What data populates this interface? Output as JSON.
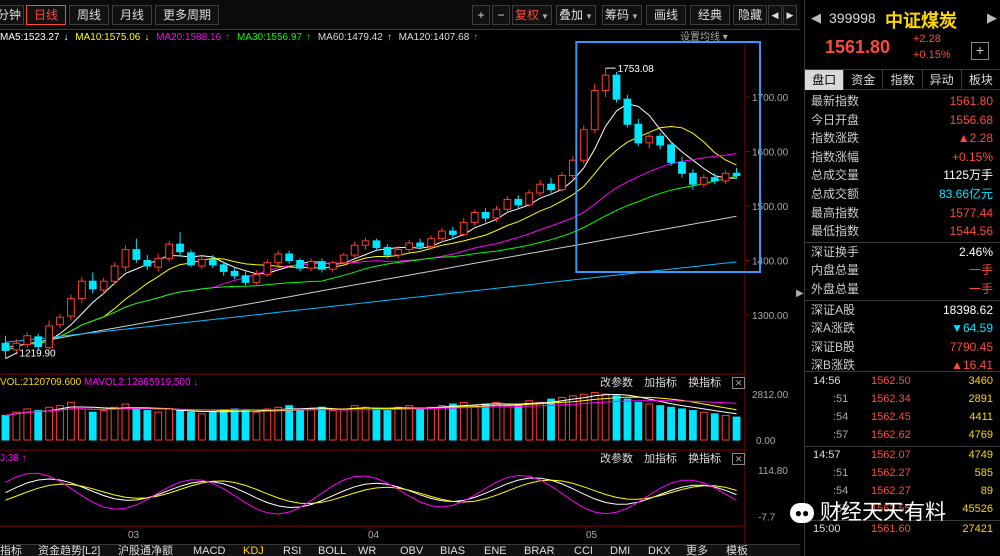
{
  "toolbar": {
    "left_items": [
      "分钟",
      "日线",
      "周线",
      "月线",
      "更多周期"
    ],
    "active": "日线",
    "right_items": [
      "+",
      "−",
      "复权",
      "叠加",
      "筹码",
      "画线",
      "经典",
      "隐藏"
    ],
    "fuquan_label": "复权",
    "nav_prev": "◀",
    "nav_next": "▶"
  },
  "ma_legend": {
    "ma5": "MA5:1523.27",
    "ma10": "MA10:1575.06",
    "ma20": "MA20:1588.16",
    "ma30": "MA30:1556.97",
    "ma60": "MA60:1479.42",
    "ma120": "MA120:1407.68",
    "settings": "设置均线"
  },
  "colors": {
    "up": "#ff3b30",
    "down": "#00e5ff",
    "ma5": "#ffffff",
    "ma10": "#ffff00",
    "ma20": "#ff00ff",
    "ma30": "#00ff00",
    "ma60": "#cccccc",
    "ma120": "#00bfff",
    "highlight": "#3399ff"
  },
  "chart_data": {
    "type": "candlestick",
    "y_ticks": [
      "1700.00",
      "1600.00",
      "1500.00",
      "1400.00",
      "1300.00"
    ],
    "annotations": {
      "high": "1753.08",
      "low": "1219.90"
    },
    "months": [
      "03",
      "04",
      "05"
    ],
    "candles": [
      [
        1248,
        1235,
        1262,
        1220
      ],
      [
        1236,
        1248,
        1256,
        1228
      ],
      [
        1246,
        1262,
        1268,
        1240
      ],
      [
        1260,
        1242,
        1266,
        1236
      ],
      [
        1240,
        1280,
        1290,
        1236
      ],
      [
        1282,
        1296,
        1302,
        1276
      ],
      [
        1298,
        1330,
        1338,
        1290
      ],
      [
        1330,
        1362,
        1370,
        1322
      ],
      [
        1362,
        1348,
        1378,
        1340
      ],
      [
        1346,
        1362,
        1368,
        1338
      ],
      [
        1362,
        1390,
        1396,
        1356
      ],
      [
        1388,
        1420,
        1428,
        1380
      ],
      [
        1420,
        1402,
        1440,
        1396
      ],
      [
        1400,
        1390,
        1410,
        1382
      ],
      [
        1388,
        1404,
        1412,
        1380
      ],
      [
        1404,
        1430,
        1436,
        1398
      ],
      [
        1430,
        1416,
        1452,
        1410
      ],
      [
        1414,
        1392,
        1420,
        1388
      ],
      [
        1390,
        1402,
        1408,
        1384
      ],
      [
        1402,
        1392,
        1410,
        1386
      ],
      [
        1392,
        1380,
        1398,
        1372
      ],
      [
        1380,
        1372,
        1388,
        1366
      ],
      [
        1372,
        1360,
        1380,
        1354
      ],
      [
        1360,
        1374,
        1382,
        1356
      ],
      [
        1374,
        1396,
        1402,
        1370
      ],
      [
        1396,
        1412,
        1418,
        1390
      ],
      [
        1412,
        1400,
        1418,
        1394
      ],
      [
        1400,
        1386,
        1404,
        1380
      ],
      [
        1386,
        1398,
        1404,
        1380
      ],
      [
        1398,
        1384,
        1404,
        1378
      ],
      [
        1384,
        1396,
        1400,
        1378
      ],
      [
        1396,
        1410,
        1414,
        1390
      ],
      [
        1410,
        1428,
        1434,
        1404
      ],
      [
        1428,
        1436,
        1442,
        1420
      ],
      [
        1436,
        1424,
        1440,
        1418
      ],
      [
        1424,
        1410,
        1430,
        1404
      ],
      [
        1410,
        1420,
        1426,
        1404
      ],
      [
        1420,
        1432,
        1438,
        1414
      ],
      [
        1432,
        1426,
        1440,
        1420
      ],
      [
        1426,
        1440,
        1446,
        1420
      ],
      [
        1440,
        1454,
        1460,
        1434
      ],
      [
        1454,
        1448,
        1462,
        1440
      ],
      [
        1448,
        1470,
        1478,
        1444
      ],
      [
        1470,
        1488,
        1494,
        1464
      ],
      [
        1488,
        1478,
        1496,
        1470
      ],
      [
        1478,
        1494,
        1500,
        1470
      ],
      [
        1494,
        1512,
        1518,
        1488
      ],
      [
        1512,
        1502,
        1520,
        1496
      ],
      [
        1502,
        1524,
        1530,
        1498
      ],
      [
        1524,
        1540,
        1548,
        1518
      ],
      [
        1540,
        1530,
        1552,
        1524
      ],
      [
        1530,
        1556,
        1562,
        1526
      ],
      [
        1556,
        1584,
        1592,
        1550
      ],
      [
        1584,
        1640,
        1648,
        1578
      ],
      [
        1640,
        1712,
        1724,
        1634
      ],
      [
        1712,
        1740,
        1753,
        1700
      ],
      [
        1740,
        1696,
        1746,
        1690
      ],
      [
        1696,
        1650,
        1704,
        1644
      ],
      [
        1650,
        1616,
        1660,
        1610
      ],
      [
        1616,
        1628,
        1636,
        1606
      ],
      [
        1628,
        1612,
        1634,
        1604
      ],
      [
        1612,
        1580,
        1618,
        1574
      ],
      [
        1580,
        1560,
        1590,
        1552
      ],
      [
        1560,
        1540,
        1568,
        1530
      ],
      [
        1540,
        1552,
        1558,
        1534
      ],
      [
        1552,
        1546,
        1560,
        1540
      ],
      [
        1546,
        1560,
        1566,
        1540
      ],
      [
        1560,
        1556,
        1570,
        1550
      ]
    ],
    "highlight_box": true
  },
  "volume": {
    "legend_vol": "VOL:2120709.600",
    "legend_mavol": "MAVOL2:12865919.500",
    "axis_top": "2812.00",
    "axis_bottom": "0.00",
    "values": [
      1500,
      1700,
      1900,
      1800,
      2000,
      2100,
      2300,
      1900,
      1700,
      1800,
      2000,
      2200,
      1900,
      1800,
      1700,
      1900,
      1800,
      1700,
      1600,
      1700,
      1800,
      1900,
      1800,
      1700,
      1900,
      2000,
      2100,
      1800,
      1900,
      2000,
      1800,
      1900,
      2100,
      2000,
      1900,
      1800,
      2000,
      2100,
      1900,
      2000,
      2100,
      2200,
      2300,
      2100,
      2200,
      2300,
      2100,
      2200,
      2400,
      2300,
      2500,
      2600,
      2700,
      2800,
      2900,
      2812,
      2700,
      2500,
      2300,
      2200,
      2100,
      2000,
      1900,
      1800,
      1700,
      1600,
      1500,
      1400
    ]
  },
  "kdj": {
    "legend": "J:38",
    "axis_top": "114.80",
    "axis_bottom": "-7.7"
  },
  "pane_links": {
    "change_params": "改参数",
    "add_indicator": "加指标",
    "swap_indicator": "换指标",
    "close": "✕"
  },
  "bottom_tabs": [
    "指标",
    "资金趋势[L2]",
    "沪股通净额",
    "MACD",
    "KDJ",
    "RSI",
    "BOLL",
    "WR",
    "OBV",
    "BIAS",
    "ENE",
    "BRAR",
    "CCI",
    "DMI",
    "DKX",
    "更多",
    "模板"
  ],
  "bottom_active": "KDJ",
  "quote": {
    "code": "399998",
    "name": "中证煤炭",
    "price": "1561.80",
    "change": "+2.28",
    "change_pct": "+0.15%",
    "prev_arrow": "◀",
    "next_arrow": "▶",
    "plus": "+"
  },
  "right_tabs": [
    "盘口",
    "资金",
    "指数",
    "异动",
    "板块"
  ],
  "right_active": "盘口",
  "stats": [
    {
      "label": "最新指数",
      "value": "1561.80",
      "color": "#ff4a3a"
    },
    {
      "label": "今日开盘",
      "value": "1556.68",
      "color": "#ff4a3a"
    },
    {
      "label": "指数涨跌",
      "value": "▲2.28",
      "color": "#ff4a3a"
    },
    {
      "label": "指数涨幅",
      "value": "+0.15%",
      "color": "#ff4a3a"
    },
    {
      "label": "总成交量",
      "value": "1125万手",
      "color": "#ffffff"
    },
    {
      "label": "总成交额",
      "value": "83.66亿元",
      "color": "#00e5ff"
    },
    {
      "label": "最高指数",
      "value": "1577.44",
      "color": "#ff4a3a"
    },
    {
      "label": "最低指数",
      "value": "1544.56",
      "color": "#ff4a3a"
    },
    {
      "label": "深证换手",
      "value": "2.46%",
      "color": "#ffffff"
    },
    {
      "label": "内盘总量",
      "value": "一手",
      "color": "#ff4a3a"
    },
    {
      "label": "外盘总量",
      "value": "一手",
      "color": "#ff4a3a"
    },
    {
      "label": "深证A股",
      "value": "18398.62",
      "color": "#ffffff"
    },
    {
      "label": "深A涨跌",
      "value": "▼64.59",
      "color": "#00e5ff"
    },
    {
      "label": "深证B股",
      "value": "7790.45",
      "color": "#ff4a3a"
    },
    {
      "label": "深B涨跌",
      "value": "▲16.41",
      "color": "#ff4a3a"
    }
  ],
  "ticks": [
    {
      "time": "14:56",
      "price": "1562.50",
      "vol": "3460",
      "dim": false
    },
    {
      "time": ":51",
      "price": "1562.34",
      "vol": "2891",
      "dim": true
    },
    {
      "time": ":54",
      "price": "1562.45",
      "vol": "4411",
      "dim": true
    },
    {
      "time": ":57",
      "price": "1562.62",
      "vol": "4769",
      "dim": true
    },
    {
      "time": "14:57",
      "price": "1562.07",
      "vol": "4749",
      "dim": false
    },
    {
      "time": ":51",
      "price": "1562.27",
      "vol": "585",
      "dim": true
    },
    {
      "time": ":54",
      "price": "1562.27",
      "vol": "89",
      "dim": true
    },
    {
      "time": ":57",
      "price": "1562.55",
      "vol": "45526",
      "dim": true
    },
    {
      "time": "15:00",
      "price": "1561.60",
      "vol": "27421",
      "dim": false
    }
  ],
  "watermark": {
    "icon": "●●",
    "text": "财经天天有料"
  }
}
